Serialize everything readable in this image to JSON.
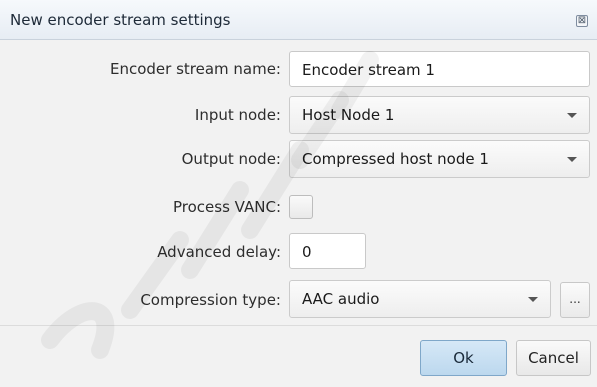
{
  "window": {
    "title": "New encoder stream settings",
    "close_glyph": "⊠"
  },
  "form": {
    "stream_name_label": "Encoder stream name:",
    "stream_name_value": "Encoder stream 1",
    "input_node_label": "Input node:",
    "input_node_value": "Host Node 1",
    "output_node_label": "Output node:",
    "output_node_value": "Compressed host node 1",
    "process_vanc_label": "Process VANC:",
    "process_vanc_checked": false,
    "advanced_delay_label": "Advanced delay:",
    "advanced_delay_value": "0",
    "compression_type_label": "Compression type:",
    "compression_type_value": "AAC audio",
    "ellipsis_label": "..."
  },
  "buttons": {
    "ok": "Ok",
    "cancel": "Cancel"
  },
  "icons": {
    "close": "close-icon",
    "dropdown": "chevron-down-icon"
  },
  "colors": {
    "ok_button": "#bcd8ee",
    "watermark": "#000000"
  }
}
